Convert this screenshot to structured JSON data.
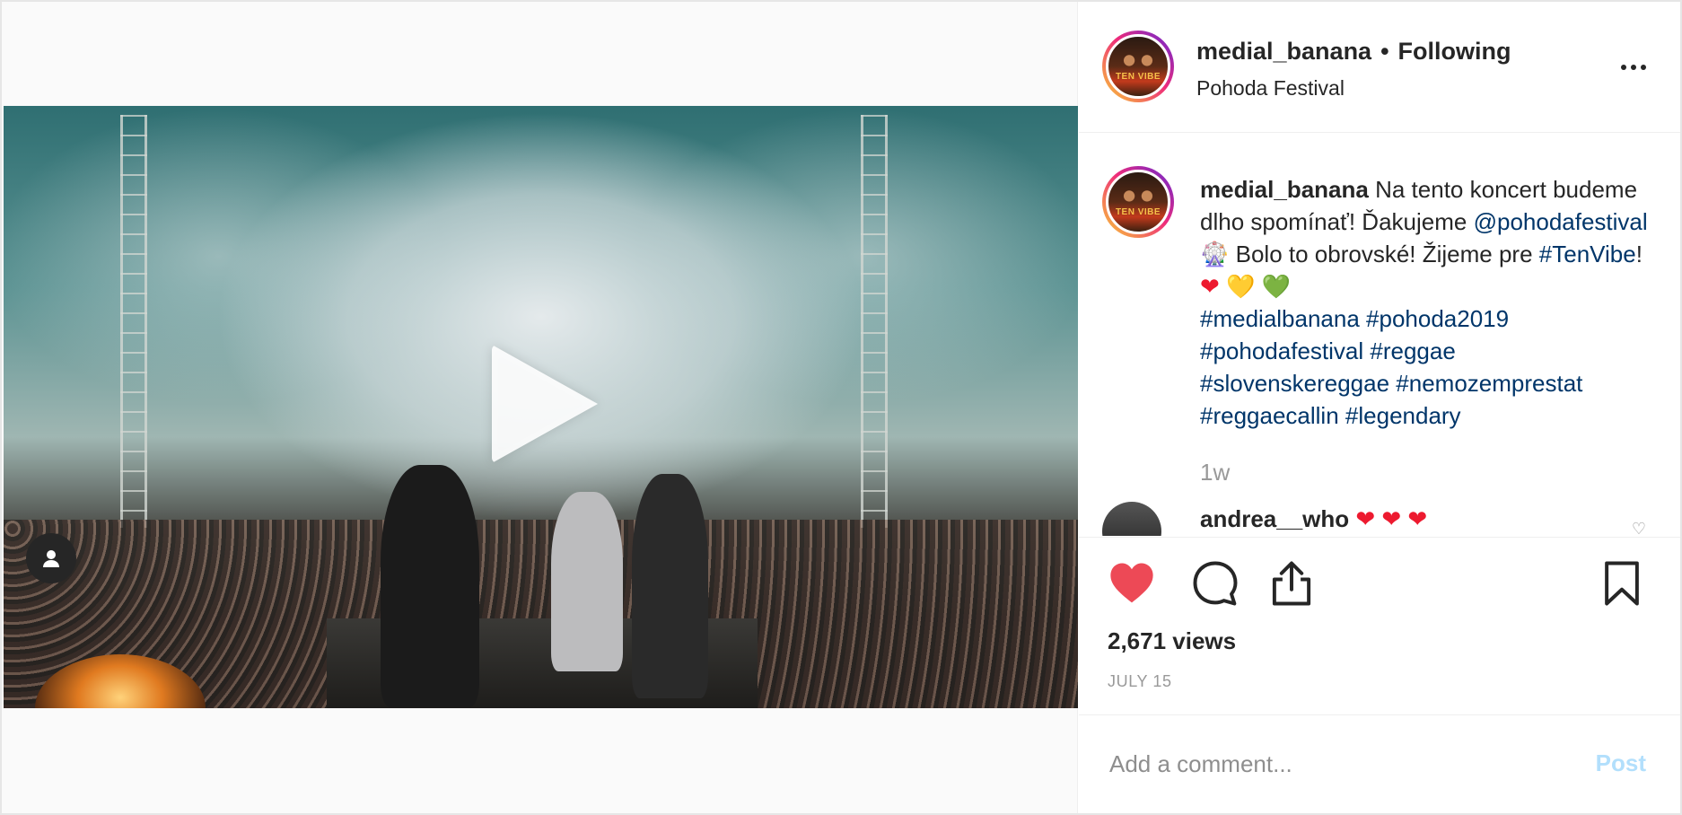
{
  "header": {
    "username": "medial_banana",
    "separator": "•",
    "follow_status": "Following",
    "location": "Pohoda Festival",
    "avatar_text": "TEN VIBE"
  },
  "caption": {
    "username": "medial_banana",
    "text_1": "Na tento koncert budeme dlho spomínať! Ďakujeme",
    "mention": "@pohodafestival",
    "emoji_wheel": "🎡",
    "text_2": "Bolo to obrovské! Žijeme pre",
    "hashtag_tenvibe": "#TenVibe",
    "text_3": "!",
    "heart_red": "❤",
    "heart_yellow": "💛",
    "heart_green": "💚",
    "hashtags": [
      "#medialbanana",
      "#pohoda2019",
      "#pohodafestival",
      "#reggae",
      "#slovenskereggae",
      "#nemozemprestat",
      "#reggaecallin",
      "#legendary"
    ],
    "time": "1w"
  },
  "comment_2": {
    "username": "andrea__who",
    "hearts": "❤ ❤ ❤"
  },
  "stats": {
    "views": "2,671 views",
    "date": "JULY 15"
  },
  "add_comment": {
    "placeholder": "Add a comment...",
    "post_label": "Post"
  },
  "colors": {
    "like_active": "#ed4956",
    "link": "#003569",
    "post_disabled": "#b2dffc",
    "muted": "#999999"
  },
  "icons": [
    "play-icon",
    "user-tag-icon",
    "more-icon",
    "heart-icon",
    "comment-icon",
    "share-icon",
    "bookmark-icon"
  ]
}
